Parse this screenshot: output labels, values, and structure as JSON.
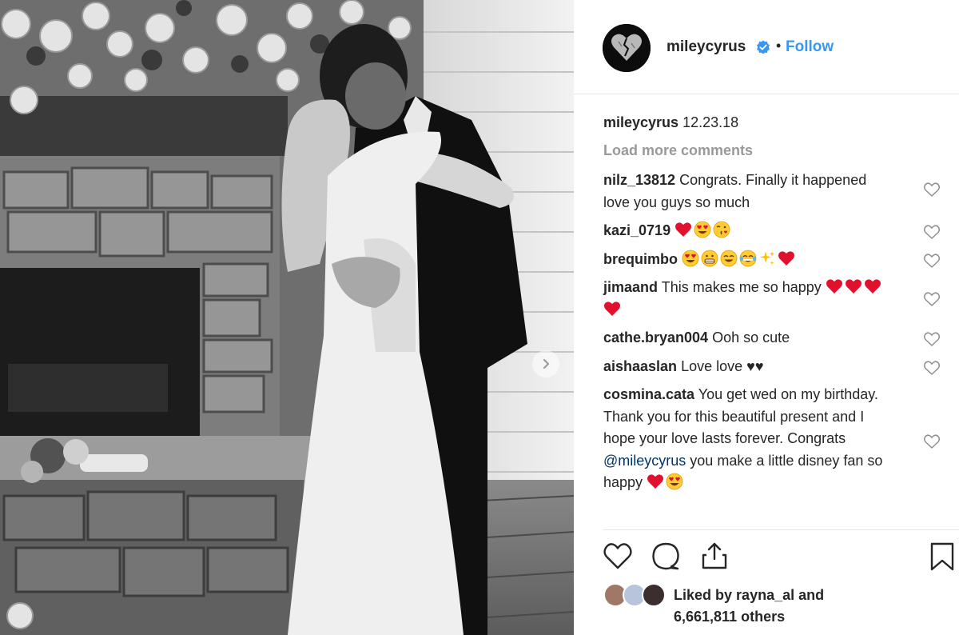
{
  "post": {
    "username": "mileycyrus",
    "follow_label": "Follow",
    "separator": "•",
    "caption_user": "mileycyrus",
    "caption_text": "12.23.18",
    "load_more": "Load more comments"
  },
  "comments": [
    {
      "user": "nilz_13812",
      "text": "Congrats. Finally it happened love you guys so much",
      "emojis": []
    },
    {
      "user": "kazi_0719",
      "text": "",
      "emojis": [
        "red-heart",
        "heart-eyes",
        "kiss-face"
      ]
    },
    {
      "user": "brequimbo",
      "text": "",
      "emojis": [
        "heart-eyes",
        "grin",
        "smile",
        "joy",
        "sparkles",
        "red-heart"
      ]
    },
    {
      "user": "jimaand",
      "text": "This makes me so happy",
      "emojis": [
        "red-heart",
        "red-heart",
        "red-heart",
        "red-heart"
      ]
    },
    {
      "user": "cathe.bryan004",
      "text": "Ooh so cute",
      "emojis": []
    },
    {
      "user": "aishaaslan",
      "text": "Love love ♥♥",
      "emojis": []
    },
    {
      "user": "cosmina.cata",
      "text_before": "You get wed on my birthday. Thank you for this beautiful present and I hope your love lasts forever. Congrats",
      "mention": "@mileycyrus",
      "text_after": "you make a little disney fan so happy",
      "emojis": [
        "red-heart",
        "heart-eyes"
      ]
    }
  ],
  "likes": {
    "prefix": "Liked by",
    "user": "rayna_al",
    "and": "and",
    "count_text": "6,661,811 others"
  },
  "colors": {
    "link_blue": "#3897f0",
    "muted_gray": "#999999",
    "heart_red": "#e0102f",
    "divider": "#e6e6e6"
  },
  "icons": [
    "verified-badge-icon",
    "heart-outline-icon",
    "comment-bubble-icon",
    "share-icon",
    "bookmark-icon",
    "chevron-right-icon"
  ]
}
